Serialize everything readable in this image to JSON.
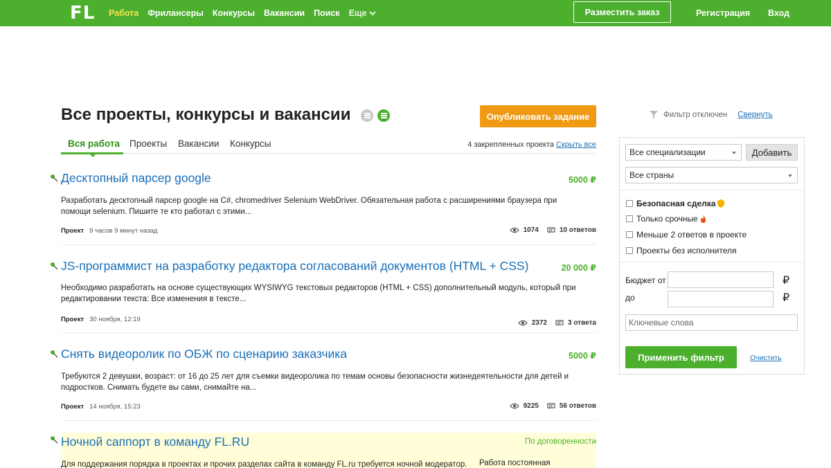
{
  "header": {
    "logo": "FL",
    "nav": [
      "Работа",
      "Фрилансеры",
      "Конкурсы",
      "Вакансии",
      "Поиск"
    ],
    "more": "Еще",
    "post_order": "Разместить заказ",
    "register": "Регистрация",
    "login": "Вход"
  },
  "page": {
    "title": "Все проекты, конкурсы и вакансии",
    "publish_button": "Опубликовать задание",
    "tabs": [
      "Вся работа",
      "Проекты",
      "Вакансии",
      "Конкурсы"
    ],
    "pinned_text": "4 закрепленных проекта",
    "pinned_link": "Скрыть все"
  },
  "projects": [
    {
      "title": "Десктопный парсер google",
      "budget": "5000 ₽",
      "description": "Разработать десктопный парсер google на C#, chromedriver Selenium WebDriver. Обязательная работа с расширениями браузера при помощи selenium. Пишите те кто работал с этими...",
      "type": "Проект",
      "time": "9 часов 9 минут назад",
      "views": "1074",
      "answers": "10 ответов"
    },
    {
      "title": "JS-программист на разработку редактора согласований документов (HTML + CSS)",
      "budget": "20 000 ₽",
      "description": "Необходимо разработать на основе существующих WYSIWYG текстовых редакторов (HTML + CSS) дополнительный модуль, который при редактировании текста: Все изменения в тексте...",
      "type": "Проект",
      "time": "30 ноября, 12:19",
      "views": "2372",
      "answers": "3 ответа"
    },
    {
      "title": "Снять видеоролик по ОБЖ по сценарию заказчика",
      "budget": "5000 ₽",
      "description": "Требуются 2 девушки, возраст: от 16 до 25 лет для съемки видеоролика по темам основы безопасности жизнедеятельности для детей и подростков. Снимать будете вы сами, снимайте на...",
      "type": "Проект",
      "time": "14 ноября, 15:23",
      "views": "9225",
      "answers": "56 ответов"
    },
    {
      "title": "Ночной саппорт в команду FL.RU",
      "budget": "По договоренности",
      "description": "Для поддержания порядка в проектах и прочих разделах сайта в команду FL.ru требуется ночной модератор.",
      "extra": "Работа постоянная"
    }
  ],
  "filter": {
    "status": "Фильтр отключен",
    "collapse": "Свернуть",
    "specialization": "Все специализации",
    "add": "Добавить",
    "country": "Все страны",
    "checkboxes": [
      "Безопасная сделка",
      "Только срочные",
      "Меньше 2 ответов в проекте",
      "Проекты без исполнителя"
    ],
    "budget_from": "Бюджет от",
    "budget_to": "до",
    "currency": "₽",
    "keywords_placeholder": "Ключевые слова",
    "apply": "Применить фильтр",
    "clear": "Очистить"
  },
  "colors": {
    "brand_green": "#4caf2e",
    "orange": "#f09a13",
    "link_blue": "#1a6fb7",
    "highlight_yellow": "#fffed8"
  }
}
